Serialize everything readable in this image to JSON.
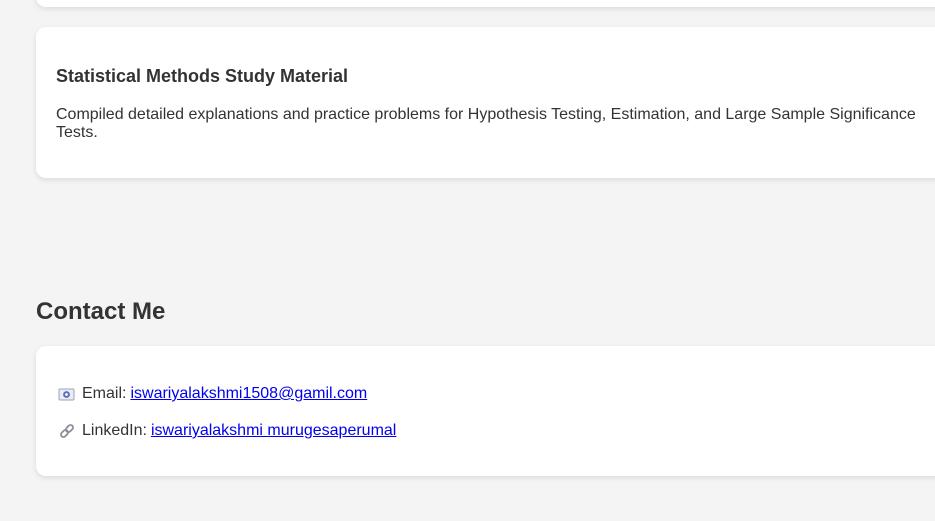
{
  "projects": [
    {
      "title": "Statistical Methods Study Material",
      "description": "Compiled detailed explanations and practice problems for Hypothesis Testing, Estimation, and Large Sample Significance Tests."
    }
  ],
  "contact": {
    "heading": "Contact Me",
    "email": {
      "icon": "email-icon",
      "label": "Email:",
      "value": "iswariyalakshmi1508@gamil.com"
    },
    "linkedin": {
      "icon": "link-icon",
      "label": "LinkedIn:",
      "value": "iswariyalakshmi murugesaperumal"
    }
  },
  "colors": {
    "background": "#f4f4f4",
    "card": "#ffffff",
    "text": "#333333",
    "link": "#0000ee"
  }
}
